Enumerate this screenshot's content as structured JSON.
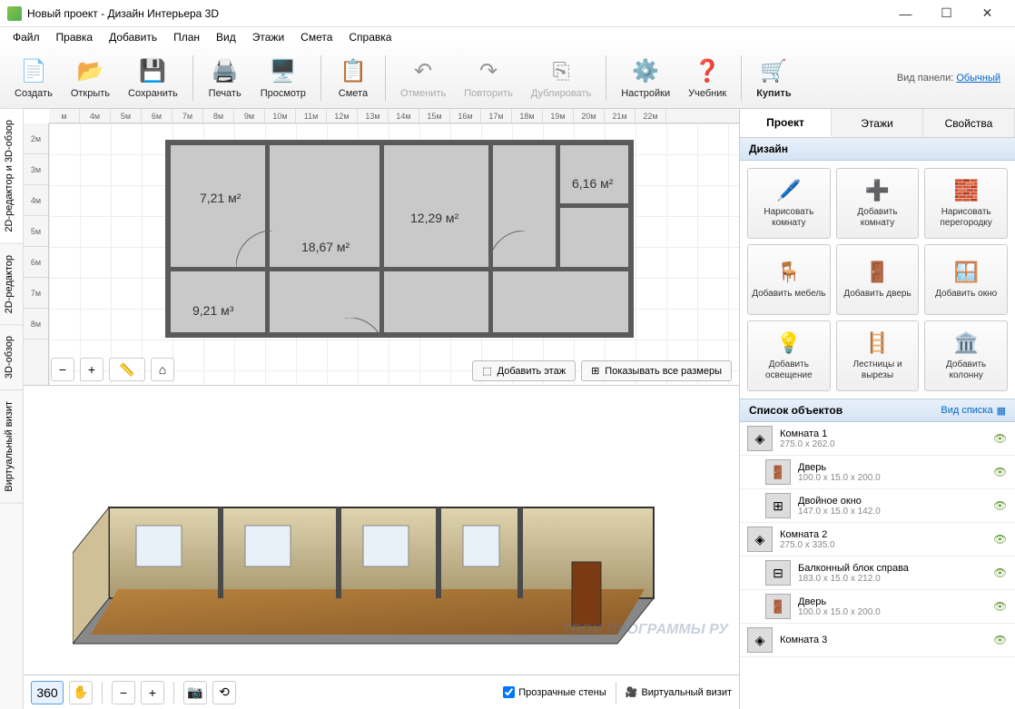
{
  "window": {
    "title": "Новый проект - Дизайн Интерьера 3D"
  },
  "menu": [
    "Файл",
    "Правка",
    "Добавить",
    "План",
    "Вид",
    "Этажи",
    "Смета",
    "Справка"
  ],
  "toolbar": {
    "create": "Создать",
    "open": "Открыть",
    "save": "Сохранить",
    "print": "Печать",
    "preview": "Просмотр",
    "estimate": "Смета",
    "undo": "Отменить",
    "redo": "Повторить",
    "duplicate": "Дублировать",
    "settings": "Настройки",
    "manual": "Учебник",
    "buy": "Купить"
  },
  "panel_mode": {
    "label": "Вид панели:",
    "value": "Обычный"
  },
  "side_tabs": [
    "2D-редактор и 3D-обзор",
    "2D-редактор",
    "3D-обзор",
    "Виртуальный визит"
  ],
  "ruler_h": [
    "м",
    "4м",
    "5м",
    "6м",
    "7м",
    "8м",
    "9м",
    "10м",
    "11м",
    "12м",
    "13м",
    "14м",
    "15м",
    "16м",
    "17м",
    "18м",
    "19м",
    "20м",
    "21м",
    "22м"
  ],
  "ruler_v": [
    "2м",
    "3м",
    "4м",
    "5м",
    "6м",
    "7м",
    "8м"
  ],
  "rooms": {
    "r1": "7,21 м²",
    "r2": "18,67 м²",
    "r3": "12,29 м²",
    "r4": "6,16 м²",
    "r5": "9,21 м³"
  },
  "floor_buttons": {
    "add": "Добавить этаж",
    "dims": "Показывать все размеры"
  },
  "bottom": {
    "transparent": "Прозрачные стены",
    "walk": "Виртуальный визит"
  },
  "right": {
    "tabs": [
      "Проект",
      "Этажи",
      "Свойства"
    ],
    "design_hdr": "Дизайн",
    "cells": [
      "Нарисовать комнату",
      "Добавить комнату",
      "Нарисовать перегородку",
      "Добавить мебель",
      "Добавить дверь",
      "Добавить окно",
      "Добавить освещение",
      "Лестницы и вырезы",
      "Добавить колонну"
    ],
    "objects_hdr": "Список объектов",
    "view_list": "Вид списка",
    "objects": [
      {
        "name": "Комната 1",
        "dims": "275.0 x 262.0",
        "child": false,
        "thumb": "◈"
      },
      {
        "name": "Дверь",
        "dims": "100.0 x 15.0 x 200.0",
        "child": true,
        "thumb": "🚪"
      },
      {
        "name": "Двойное окно",
        "dims": "147.0 x 15.0 x 142.0",
        "child": true,
        "thumb": "⊞"
      },
      {
        "name": "Комната 2",
        "dims": "275.0 x 335.0",
        "child": false,
        "thumb": "◈"
      },
      {
        "name": "Балконный блок справа",
        "dims": "183.0 x 15.0 x 212.0",
        "child": true,
        "thumb": "⊟"
      },
      {
        "name": "Дверь",
        "dims": "100.0 x 15.0 x 200.0",
        "child": true,
        "thumb": "🚪"
      },
      {
        "name": "Комната 3",
        "dims": "",
        "child": false,
        "thumb": "◈"
      }
    ]
  },
  "watermark": "ТВОИ ПРОГРАММЫ РУ"
}
